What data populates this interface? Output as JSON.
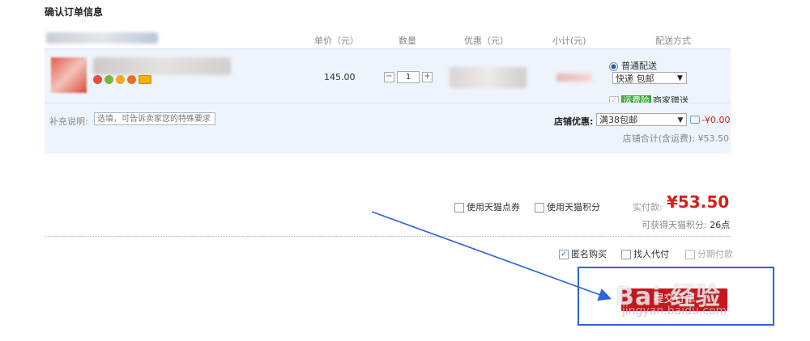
{
  "title": "确认订单信息",
  "columns": {
    "price": "单价（元）",
    "qty": "数量",
    "discount": "优惠（元）",
    "subtotal": "小计(元)",
    "shipping": "配送方式"
  },
  "item": {
    "price": "145.00",
    "qty": "1",
    "minus": "−",
    "plus": "+"
  },
  "shipping": {
    "normal_label": "普通配送",
    "method": "快递 包邮",
    "freight_insurance": "运费险",
    "merchant_gift": "商家赠送"
  },
  "note": {
    "label": "补充说明:",
    "placeholder": "选填，可告诉卖家您的特殊要求"
  },
  "shop": {
    "discount_label": "店铺优惠:",
    "discount_option": "满38包邮",
    "discount_amount": "-¥0.00",
    "total": "店铺合计(含运费): ¥53.50"
  },
  "payment": {
    "tmall_coupon": "使用天猫点券",
    "tmall_points": "使用天猫积分",
    "paid_label": "实付款:",
    "paid_value": "¥53.50",
    "points_label": "可获得天猫积分:",
    "points_value": "26点"
  },
  "bottom": {
    "anonymous": "匿名购买",
    "proxy": "找人代付",
    "installment": "分期付款",
    "submit": "提交订单"
  },
  "watermark": {
    "text": "Bai 经验",
    "url": "jingyan.baidu.com"
  },
  "colors": {
    "accent_red": "#d3201b",
    "submit_bg": "#c8161d",
    "highlight_blue": "#2e63d9",
    "row_bg": "#eef4fb"
  }
}
